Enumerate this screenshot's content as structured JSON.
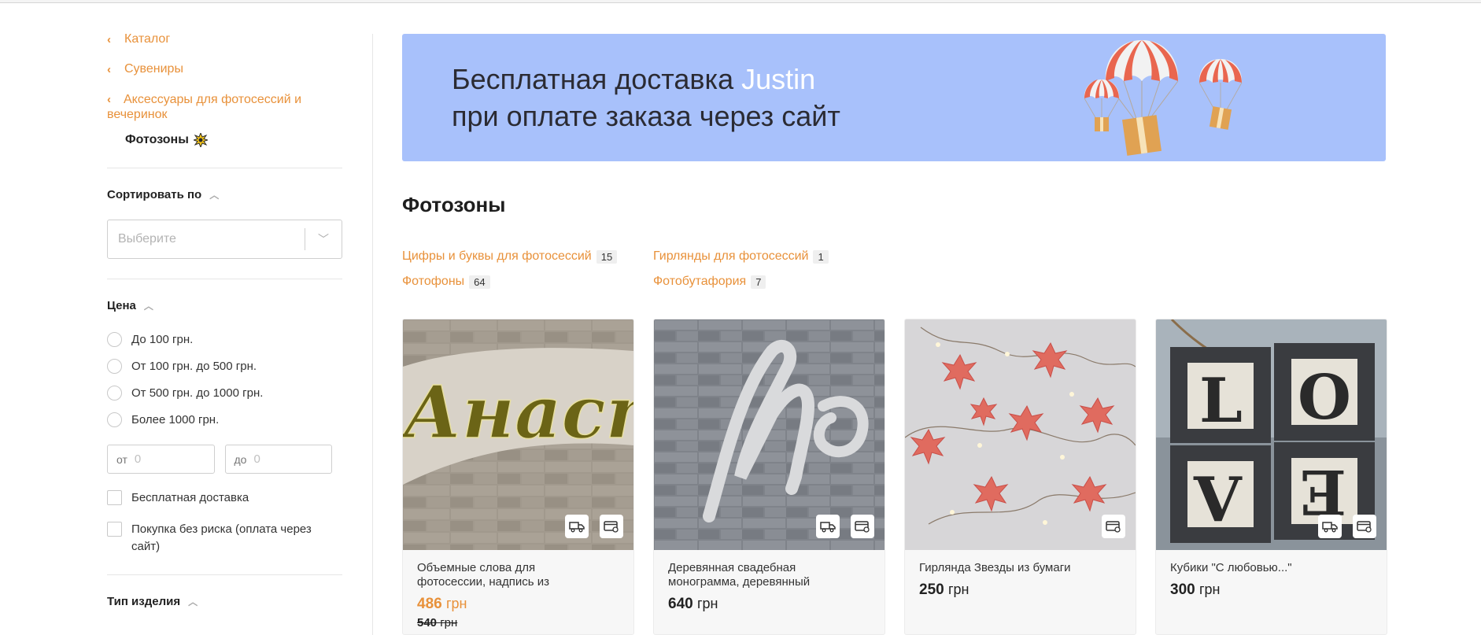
{
  "breadcrumbs": [
    {
      "label": "Каталог"
    },
    {
      "label": "Сувениры"
    },
    {
      "label": "Аксессуары для фотосессий и вечеринок"
    }
  ],
  "current_category": "Фотозоны",
  "sort": {
    "title": "Сортировать по",
    "placeholder": "Выберите"
  },
  "price_filter": {
    "title": "Цена",
    "options": [
      "До 100 грн.",
      "От 100 грн. до 500 грн.",
      "От 500 грн. до 1000 грн.",
      "Более 1000 грн."
    ],
    "from_label": "от",
    "from_value": "0",
    "to_label": "до",
    "to_value": "0"
  },
  "checkboxes": {
    "free_delivery": "Бесплатная доставка",
    "no_risk": "Покупка без риска (оплата через сайт)"
  },
  "type_filter": {
    "title": "Тип изделия"
  },
  "banner": {
    "line1_pre": "Бесплатная доставка ",
    "line1_highlight": "Justin",
    "line2": "при оплате заказа через сайт",
    "bg_color": "#a8c1fb"
  },
  "page_title": "Фотозоны",
  "subcategories": [
    {
      "label": "Цифры и буквы для фотосессий",
      "count": "15"
    },
    {
      "label": "Гирлянды для фотосессий",
      "count": "1"
    },
    {
      "label": "Фотофоны",
      "count": "64"
    },
    {
      "label": "Фотобутафория",
      "count": "7"
    }
  ],
  "products": [
    {
      "name": "Объемные слова для фотосессии, надпись из",
      "price": "486",
      "currency": "грн",
      "old_price": "540",
      "badges": [
        "truck-icon",
        "card-icon"
      ]
    },
    {
      "name": "Деревянная свадебная монограмма, деревянный",
      "price": "640",
      "currency": "грн",
      "badges": [
        "truck-icon",
        "card-icon"
      ]
    },
    {
      "name": "Гирлянда Звезды из бумаги",
      "price": "250",
      "currency": "грн",
      "badges": [
        "card-icon"
      ]
    },
    {
      "name": "Кубики \"С любовью...\"",
      "price": "300",
      "currency": "грн",
      "badges": [
        "truck-icon",
        "card-icon"
      ]
    }
  ],
  "colors": {
    "accent": "#e8913a"
  }
}
